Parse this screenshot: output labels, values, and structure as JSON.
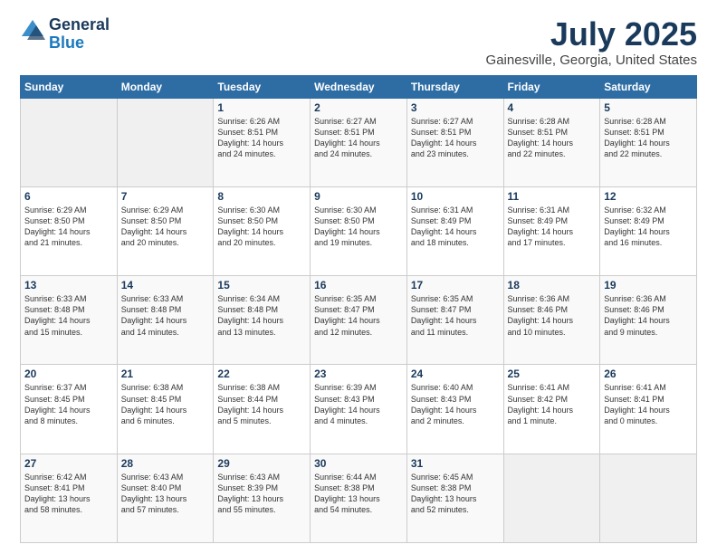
{
  "header": {
    "logo_general": "General",
    "logo_blue": "Blue",
    "title": "July 2025",
    "location": "Gainesville, Georgia, United States"
  },
  "days_of_week": [
    "Sunday",
    "Monday",
    "Tuesday",
    "Wednesday",
    "Thursday",
    "Friday",
    "Saturday"
  ],
  "weeks": [
    [
      {
        "day": "",
        "content": ""
      },
      {
        "day": "",
        "content": ""
      },
      {
        "day": "1",
        "content": "Sunrise: 6:26 AM\nSunset: 8:51 PM\nDaylight: 14 hours\nand 24 minutes."
      },
      {
        "day": "2",
        "content": "Sunrise: 6:27 AM\nSunset: 8:51 PM\nDaylight: 14 hours\nand 24 minutes."
      },
      {
        "day": "3",
        "content": "Sunrise: 6:27 AM\nSunset: 8:51 PM\nDaylight: 14 hours\nand 23 minutes."
      },
      {
        "day": "4",
        "content": "Sunrise: 6:28 AM\nSunset: 8:51 PM\nDaylight: 14 hours\nand 22 minutes."
      },
      {
        "day": "5",
        "content": "Sunrise: 6:28 AM\nSunset: 8:51 PM\nDaylight: 14 hours\nand 22 minutes."
      }
    ],
    [
      {
        "day": "6",
        "content": "Sunrise: 6:29 AM\nSunset: 8:50 PM\nDaylight: 14 hours\nand 21 minutes."
      },
      {
        "day": "7",
        "content": "Sunrise: 6:29 AM\nSunset: 8:50 PM\nDaylight: 14 hours\nand 20 minutes."
      },
      {
        "day": "8",
        "content": "Sunrise: 6:30 AM\nSunset: 8:50 PM\nDaylight: 14 hours\nand 20 minutes."
      },
      {
        "day": "9",
        "content": "Sunrise: 6:30 AM\nSunset: 8:50 PM\nDaylight: 14 hours\nand 19 minutes."
      },
      {
        "day": "10",
        "content": "Sunrise: 6:31 AM\nSunset: 8:49 PM\nDaylight: 14 hours\nand 18 minutes."
      },
      {
        "day": "11",
        "content": "Sunrise: 6:31 AM\nSunset: 8:49 PM\nDaylight: 14 hours\nand 17 minutes."
      },
      {
        "day": "12",
        "content": "Sunrise: 6:32 AM\nSunset: 8:49 PM\nDaylight: 14 hours\nand 16 minutes."
      }
    ],
    [
      {
        "day": "13",
        "content": "Sunrise: 6:33 AM\nSunset: 8:48 PM\nDaylight: 14 hours\nand 15 minutes."
      },
      {
        "day": "14",
        "content": "Sunrise: 6:33 AM\nSunset: 8:48 PM\nDaylight: 14 hours\nand 14 minutes."
      },
      {
        "day": "15",
        "content": "Sunrise: 6:34 AM\nSunset: 8:48 PM\nDaylight: 14 hours\nand 13 minutes."
      },
      {
        "day": "16",
        "content": "Sunrise: 6:35 AM\nSunset: 8:47 PM\nDaylight: 14 hours\nand 12 minutes."
      },
      {
        "day": "17",
        "content": "Sunrise: 6:35 AM\nSunset: 8:47 PM\nDaylight: 14 hours\nand 11 minutes."
      },
      {
        "day": "18",
        "content": "Sunrise: 6:36 AM\nSunset: 8:46 PM\nDaylight: 14 hours\nand 10 minutes."
      },
      {
        "day": "19",
        "content": "Sunrise: 6:36 AM\nSunset: 8:46 PM\nDaylight: 14 hours\nand 9 minutes."
      }
    ],
    [
      {
        "day": "20",
        "content": "Sunrise: 6:37 AM\nSunset: 8:45 PM\nDaylight: 14 hours\nand 8 minutes."
      },
      {
        "day": "21",
        "content": "Sunrise: 6:38 AM\nSunset: 8:45 PM\nDaylight: 14 hours\nand 6 minutes."
      },
      {
        "day": "22",
        "content": "Sunrise: 6:38 AM\nSunset: 8:44 PM\nDaylight: 14 hours\nand 5 minutes."
      },
      {
        "day": "23",
        "content": "Sunrise: 6:39 AM\nSunset: 8:43 PM\nDaylight: 14 hours\nand 4 minutes."
      },
      {
        "day": "24",
        "content": "Sunrise: 6:40 AM\nSunset: 8:43 PM\nDaylight: 14 hours\nand 2 minutes."
      },
      {
        "day": "25",
        "content": "Sunrise: 6:41 AM\nSunset: 8:42 PM\nDaylight: 14 hours\nand 1 minute."
      },
      {
        "day": "26",
        "content": "Sunrise: 6:41 AM\nSunset: 8:41 PM\nDaylight: 14 hours\nand 0 minutes."
      }
    ],
    [
      {
        "day": "27",
        "content": "Sunrise: 6:42 AM\nSunset: 8:41 PM\nDaylight: 13 hours\nand 58 minutes."
      },
      {
        "day": "28",
        "content": "Sunrise: 6:43 AM\nSunset: 8:40 PM\nDaylight: 13 hours\nand 57 minutes."
      },
      {
        "day": "29",
        "content": "Sunrise: 6:43 AM\nSunset: 8:39 PM\nDaylight: 13 hours\nand 55 minutes."
      },
      {
        "day": "30",
        "content": "Sunrise: 6:44 AM\nSunset: 8:38 PM\nDaylight: 13 hours\nand 54 minutes."
      },
      {
        "day": "31",
        "content": "Sunrise: 6:45 AM\nSunset: 8:38 PM\nDaylight: 13 hours\nand 52 minutes."
      },
      {
        "day": "",
        "content": ""
      },
      {
        "day": "",
        "content": ""
      }
    ]
  ]
}
